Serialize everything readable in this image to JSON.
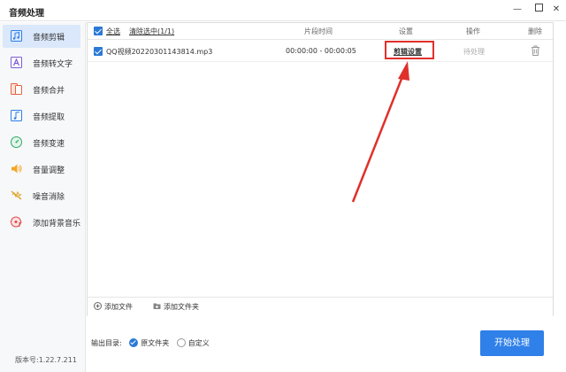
{
  "window": {
    "title": "音频处理",
    "controls": [
      "minimize-icon",
      "maximize-icon",
      "close-icon"
    ]
  },
  "sidebar": {
    "items": [
      {
        "label": "音频剪辑",
        "icon": "scissors-music-icon",
        "active": true
      },
      {
        "label": "音频转文字",
        "icon": "text-a-icon",
        "active": false
      },
      {
        "label": "音频合并",
        "icon": "merge-icon",
        "active": false
      },
      {
        "label": "音频提取",
        "icon": "extract-music-icon",
        "active": false
      },
      {
        "label": "音频变速",
        "icon": "speed-gauge-icon",
        "active": false
      },
      {
        "label": "音量调整",
        "icon": "volume-icon",
        "active": false
      },
      {
        "label": "噪音消除",
        "icon": "noise-cancel-icon",
        "active": false
      },
      {
        "label": "添加背景音乐",
        "icon": "music-disc-icon",
        "active": false
      }
    ],
    "version": "版本号:1.22.7.211"
  },
  "table": {
    "select_all": "全选",
    "clear_selected": "清除选中(1/1)",
    "headers": {
      "clip_time": "片段时间",
      "settings": "设置",
      "operation": "操作",
      "delete": "删除"
    },
    "rows": [
      {
        "file": "QQ视频20220301143814.mp3",
        "time": "00:00:00 - 00:00:05",
        "settings": "剪辑设置",
        "status": "待处理",
        "checked": true
      }
    ]
  },
  "footer": {
    "add_file": "添加文件",
    "add_folder": "添加文件夹"
  },
  "output": {
    "label": "输出目录:",
    "options": [
      {
        "label": "原文件夹",
        "selected": true
      },
      {
        "label": "自定义",
        "selected": false
      }
    ]
  },
  "start_button": "开始处理",
  "colors": {
    "accent": "#2f80e8",
    "annotation": "#e0302b",
    "active_nav": "#dbe8fb"
  }
}
